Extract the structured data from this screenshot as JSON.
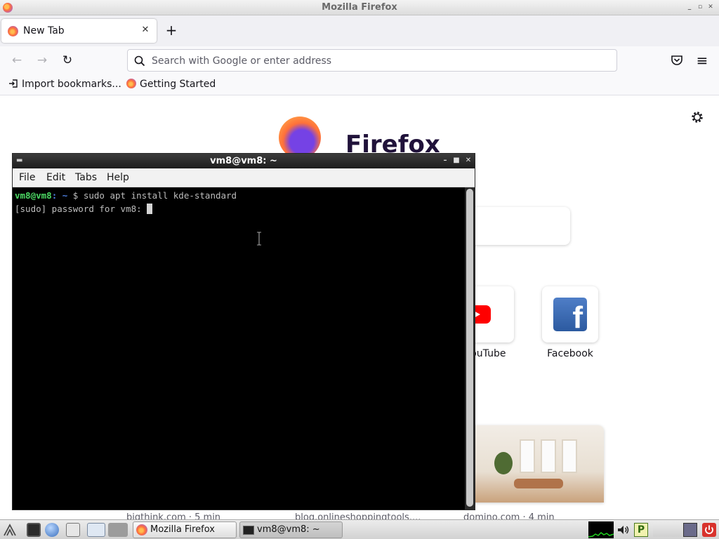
{
  "firefox": {
    "window_title": "Mozilla Firefox",
    "tab_label": "New Tab",
    "tab_close": "✕",
    "new_tab": "+",
    "nav": {
      "back": "←",
      "forward": "→",
      "reload": "↻",
      "menu": "≡"
    },
    "url_placeholder": "Search with Google or enter address",
    "bookmarks": [
      "Import bookmarks...",
      "Getting Started"
    ],
    "logo_text": "Firefox",
    "shortcuts": [
      {
        "label": "YouTube",
        "icon": "youtube-icon"
      },
      {
        "label": "Facebook",
        "icon": "facebook-icon"
      }
    ],
    "stories": [
      {
        "source": "bigthink.com · 5 min"
      },
      {
        "source": "blog.onlineshoppingtools...."
      },
      {
        "source": "domino.com · 4 min"
      }
    ]
  },
  "terminal": {
    "title": "vm8@vm8: ~",
    "menu": [
      "File",
      "Edit",
      "Tabs",
      "Help"
    ],
    "prompt_user": "vm8@vm8",
    "prompt_path": ": ~",
    "command": " $ sudo apt install kde-standard",
    "line2": "[sudo] password for vm8: "
  },
  "taskbar": {
    "tasks": [
      "Mozilla Firefox",
      "vm8@vm8: ~"
    ]
  },
  "colors": {
    "terminal_bg": "#000000",
    "prompt_green": "#4cd964",
    "firefox_accent": "#ff7139"
  }
}
